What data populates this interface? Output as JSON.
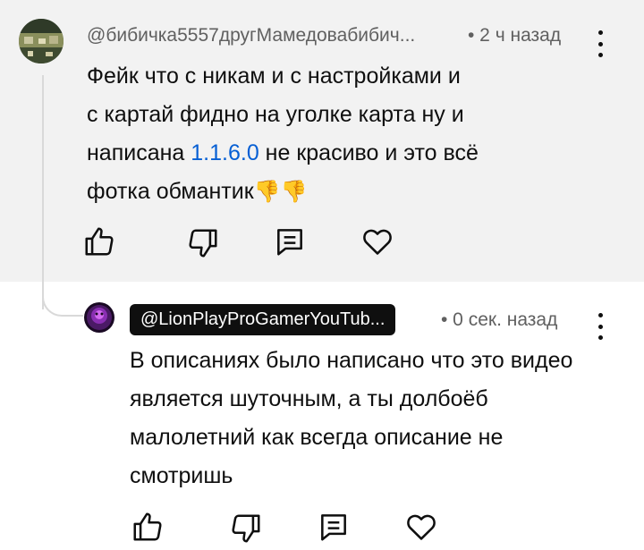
{
  "comment": {
    "author": "@бибичка5557другМамедовабибич...",
    "time": "• 2 ч назад",
    "text_line1": "Фейк  что с никам и с настройками и",
    "text_line2": "с картай фидно на уголке карта ну и",
    "text_line3_before": "написана ",
    "text_link": "1.1.6.0",
    "text_line3_after": " не красиво и это всё",
    "text_line4": "фотка обмантик",
    "emoji": "👎👎"
  },
  "reply": {
    "author": "@LionPlayProGamerYouTub...",
    "time": "• 0 сек. назад",
    "text": "В описаниях было написано что это видео является шуточным, а ты долбоёб малолетний как всегда описание не смотришь"
  },
  "colors": {
    "highlight_bg": "#f2f2f2",
    "link": "#065fd4",
    "meta_text": "#606060",
    "thread_line": "#d9d9d9",
    "author_badge_bg": "#0f0f0f"
  },
  "icons": [
    "like-icon",
    "dislike-icon",
    "reply-icon",
    "heart-icon",
    "more-vertical-icon"
  ]
}
